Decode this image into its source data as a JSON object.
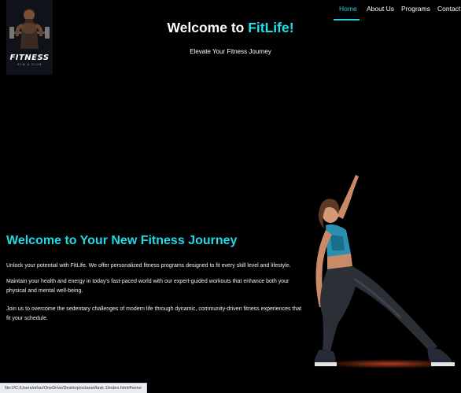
{
  "logo": {
    "word": "FITNESS",
    "tagline": "GYM & CLUB"
  },
  "nav": {
    "items": [
      {
        "label": "Home",
        "active": true
      },
      {
        "label": "About Us",
        "active": false
      },
      {
        "label": "Programs",
        "active": false
      },
      {
        "label": "Contact",
        "active": false
      }
    ]
  },
  "header": {
    "title_prefix": "Welcome to ",
    "title_brand": "FitLife!",
    "tagline": "Elevate Your Fitness Journey"
  },
  "hero": {
    "title": "Welcome to Your New Fitness Journey",
    "paragraphs": [
      "Unlock your potential with FitLife. We offer personalized fitness programs designed to fit every skill level and lifestyle.",
      "Maintain your health and energy in today's fast-paced world with our expert-guided workouts that enhance both your physical and mental well-being.",
      "Join us to overcome the sedentary challenges of modern life through dynamic, community-driven fitness experiences that fit your schedule."
    ]
  },
  "status_bar": {
    "url": "file:///C:/Users/nihar/OneDrive/Desktop/octanet/task 1/index.html#home"
  },
  "colors": {
    "accent": "#22d9e6",
    "background": "#000000",
    "nav_active": "#1fd3dd"
  }
}
